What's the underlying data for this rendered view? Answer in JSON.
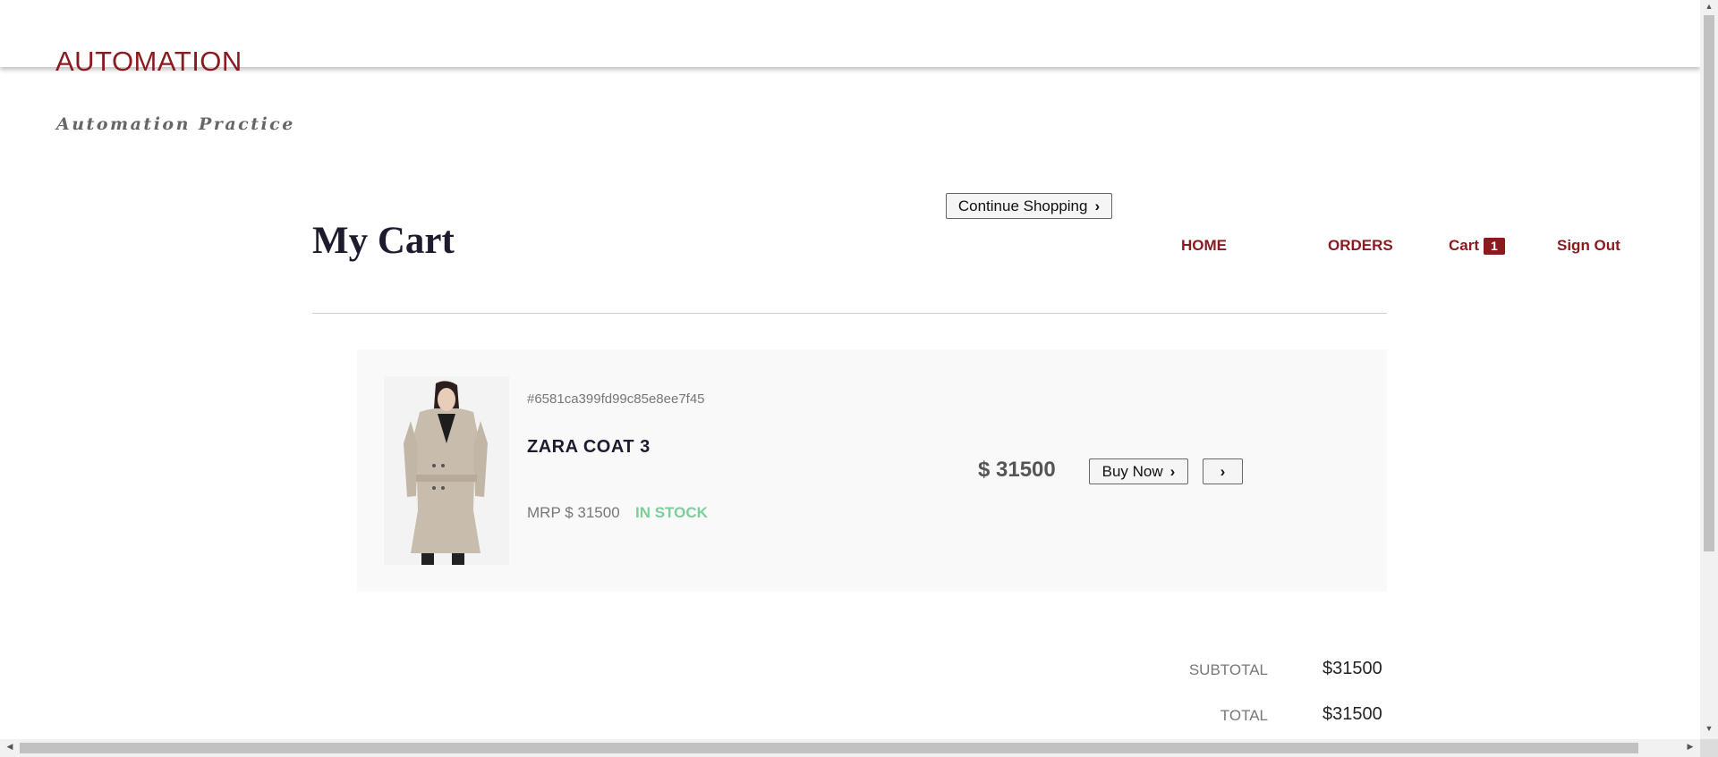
{
  "brand": {
    "title": "AUTOMATION",
    "subtitle": "Automation Practice"
  },
  "header": {
    "continue_label": "Continue Shopping",
    "page_title": "My Cart",
    "nav": {
      "home": "HOME",
      "orders": "ORDERS",
      "cart": "Cart",
      "cart_count": "1",
      "signout": "Sign Out"
    }
  },
  "cart_item": {
    "id": "#6581ca399fd99c85e8ee7f45",
    "name": "ZARA COAT 3",
    "mrp": "MRP $ 31500",
    "stock": "IN STOCK",
    "price": "$ 31500",
    "buy_label": "Buy Now"
  },
  "summary": {
    "subtotal_label": "SUBTOTAL",
    "subtotal_value": "$31500",
    "total_label": "TOTAL",
    "total_value": "$31500"
  },
  "colors": {
    "brand": "#8b1a1f",
    "stock": "#7ccf9a",
    "item_bg": "#f9f9f9"
  },
  "icons": {
    "chevron": "chevron-right-icon",
    "product_image": "coat-product-image"
  }
}
